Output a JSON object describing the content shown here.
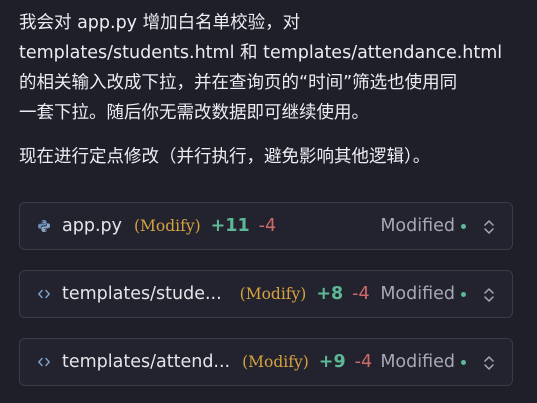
{
  "message": {
    "paragraph1": "我会对 app.py 增加白名单校验，对\ntemplates/students.html 和 templates/attendance.html\n的相关输入改成下拉，并在查询页的“时间”筛选也使用同\n一套下拉。随后你无需改数据即可继续使用。",
    "paragraph2": "现在进行定点修改（并行执行，避免影响其他逻辑）。"
  },
  "files": [
    {
      "name": "app.py",
      "icon": "python-file-icon",
      "operation": "(Modify)",
      "additions": "+11",
      "deletions": "-4",
      "status": "Modified"
    },
    {
      "name": "templates/stude...",
      "icon": "code-file-icon",
      "operation": "(Modify)",
      "additions": "+8",
      "deletions": "-4",
      "status": "Modified"
    },
    {
      "name": "templates/attend...",
      "icon": "code-file-icon",
      "operation": "(Modify)",
      "additions": "+9",
      "deletions": "-4",
      "status": "Modified"
    }
  ],
  "colors": {
    "background": "#1f1f29",
    "card_border": "#3a3b4a",
    "operation": "#d6a33f",
    "additions": "#5cb895",
    "deletions": "#d06a6a",
    "status_dot": "#5cb895"
  }
}
